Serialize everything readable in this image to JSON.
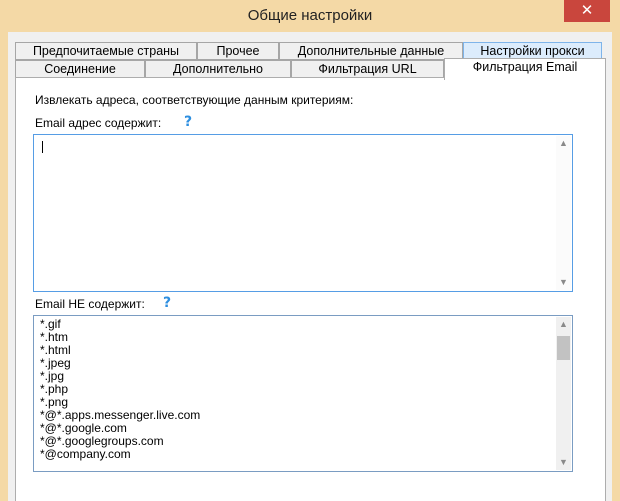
{
  "window": {
    "title": "Общие настройки",
    "close_glyph": "✕"
  },
  "tabs": {
    "row1": [
      {
        "label": "Предпочитаемые страны"
      },
      {
        "label": "Прочее"
      },
      {
        "label": "Дополнительные данные"
      },
      {
        "label": "Настройки прокси"
      }
    ],
    "row2": [
      {
        "label": "Соединение"
      },
      {
        "label": "Дополнительно"
      },
      {
        "label": "Фильтрация URL"
      },
      {
        "label": "Фильтрация Email"
      }
    ],
    "active": "Фильтрация Email",
    "hovered": "Настройки прокси"
  },
  "email_filter": {
    "intro": "Извлекать адреса, соответствующие данным критериям:",
    "contains_label": "Email адрес содержит:",
    "contains_value": "",
    "not_contains_label": "Email НЕ содержит:",
    "help_glyph": "?",
    "not_contains_items": [
      "*.gif",
      "*.htm",
      "*.html",
      "*.jpeg",
      "*.jpg",
      "*.php",
      "*.png",
      "*@*.apps.messenger.live.com",
      "*@*.google.com",
      "*@*.googlegroups.com",
      "*@company.com"
    ]
  },
  "icons": {
    "help": "help-icon",
    "close": "close-icon",
    "scroll_up": "scroll-up-arrow-icon",
    "scroll_down": "scroll-down-arrow-icon"
  }
}
